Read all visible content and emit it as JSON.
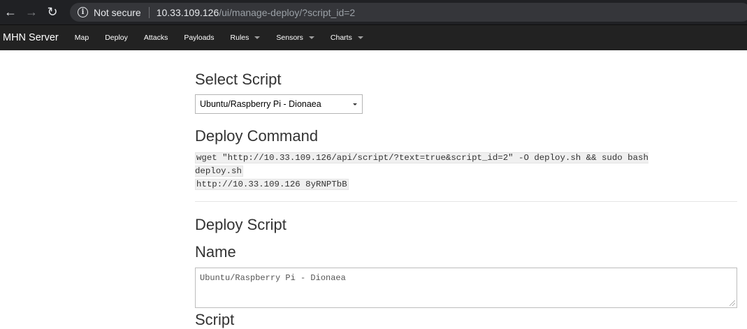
{
  "browser": {
    "not_secure": "Not secure",
    "url_host": "10.33.109.126",
    "url_path": "/ui/manage-deploy/?script_id=2"
  },
  "navbar": {
    "brand": "MHN Server",
    "items": [
      {
        "label": "Map",
        "dropdown": false
      },
      {
        "label": "Deploy",
        "dropdown": false
      },
      {
        "label": "Attacks",
        "dropdown": false
      },
      {
        "label": "Payloads",
        "dropdown": false
      },
      {
        "label": "Rules",
        "dropdown": true
      },
      {
        "label": "Sensors",
        "dropdown": true
      },
      {
        "label": "Charts",
        "dropdown": true
      }
    ]
  },
  "select_script": {
    "heading": "Select Script",
    "selected": "Ubuntu/Raspberry Pi - Dionaea"
  },
  "deploy_command": {
    "heading": "Deploy Command",
    "line1": "wget \"http://10.33.109.126/api/script/?text=true&script_id=2\" -O deploy.sh && sudo bash deploy.sh",
    "line2": "http://10.33.109.126 8yRNPTbB"
  },
  "deploy_script": {
    "heading": "Deploy Script",
    "name_label": "Name",
    "name_value": "Ubuntu/Raspberry Pi - Dionaea",
    "next_label": "Script"
  }
}
